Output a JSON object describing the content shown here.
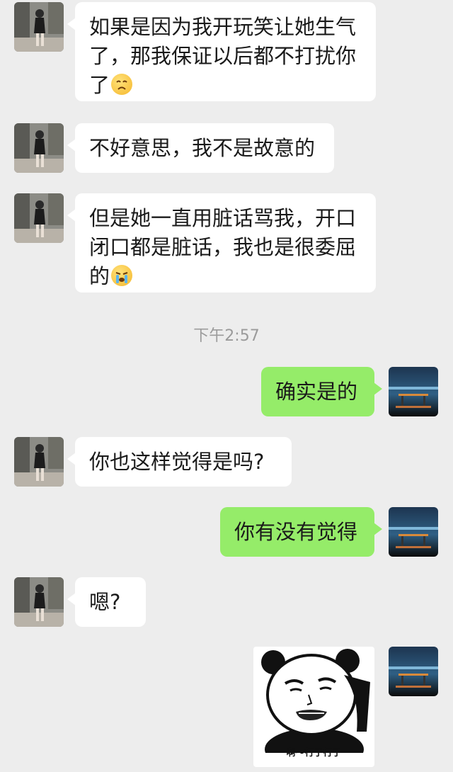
{
  "timestamp": "下午2:57",
  "messages": [
    {
      "side": "in",
      "lines": [
        "如果是因为我开玩笑让她生气",
        "了，那我保证以后都不打扰你",
        "了"
      ],
      "emoji": "sad-face-emoji"
    },
    {
      "side": "in",
      "lines": [
        "不好意思，我不是故意的"
      ]
    },
    {
      "side": "in",
      "lines": [
        "但是她一直用脏话骂我，开口",
        "闭口都是脏话，我也是很委屈",
        "的"
      ],
      "emoji": "crying-face-emoji"
    },
    {
      "side": "out",
      "lines": [
        "确实是的"
      ]
    },
    {
      "side": "in",
      "lines": [
        "你也这样觉得是吗?"
      ]
    },
    {
      "side": "out",
      "lines": [
        "你有没有觉得"
      ]
    },
    {
      "side": "in",
      "lines": [
        "嗯?"
      ]
    },
    {
      "side": "out",
      "sticker": "panda-meme-sticker",
      "caption": "啊～行了行了"
    }
  ],
  "colors": {
    "background": "#ededed",
    "incoming_bubble": "#ffffff",
    "outgoing_bubble": "#95ec69",
    "timestamp_text": "#9b9b9b"
  }
}
